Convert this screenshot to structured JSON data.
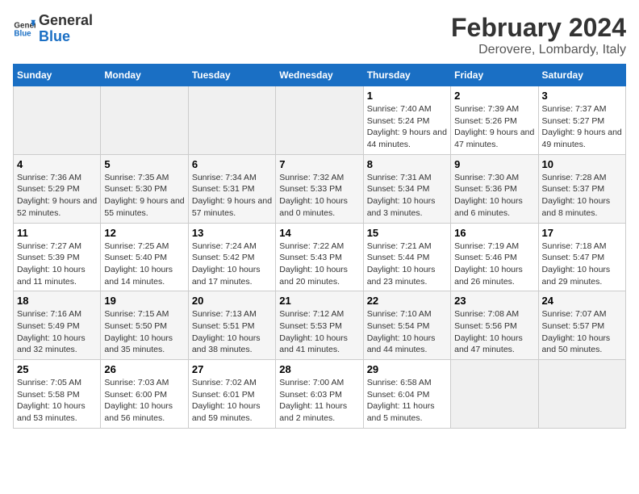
{
  "header": {
    "logo_line1": "General",
    "logo_line2": "Blue",
    "title": "February 2024",
    "subtitle": "Derovere, Lombardy, Italy"
  },
  "columns": [
    "Sunday",
    "Monday",
    "Tuesday",
    "Wednesday",
    "Thursday",
    "Friday",
    "Saturday"
  ],
  "weeks": [
    {
      "days": [
        {
          "num": "",
          "empty": true
        },
        {
          "num": "",
          "empty": true
        },
        {
          "num": "",
          "empty": true
        },
        {
          "num": "",
          "empty": true
        },
        {
          "num": "1",
          "sunrise": "Sunrise: 7:40 AM",
          "sunset": "Sunset: 5:24 PM",
          "daylight": "Daylight: 9 hours and 44 minutes."
        },
        {
          "num": "2",
          "sunrise": "Sunrise: 7:39 AM",
          "sunset": "Sunset: 5:26 PM",
          "daylight": "Daylight: 9 hours and 47 minutes."
        },
        {
          "num": "3",
          "sunrise": "Sunrise: 7:37 AM",
          "sunset": "Sunset: 5:27 PM",
          "daylight": "Daylight: 9 hours and 49 minutes."
        }
      ]
    },
    {
      "days": [
        {
          "num": "4",
          "sunrise": "Sunrise: 7:36 AM",
          "sunset": "Sunset: 5:29 PM",
          "daylight": "Daylight: 9 hours and 52 minutes."
        },
        {
          "num": "5",
          "sunrise": "Sunrise: 7:35 AM",
          "sunset": "Sunset: 5:30 PM",
          "daylight": "Daylight: 9 hours and 55 minutes."
        },
        {
          "num": "6",
          "sunrise": "Sunrise: 7:34 AM",
          "sunset": "Sunset: 5:31 PM",
          "daylight": "Daylight: 9 hours and 57 minutes."
        },
        {
          "num": "7",
          "sunrise": "Sunrise: 7:32 AM",
          "sunset": "Sunset: 5:33 PM",
          "daylight": "Daylight: 10 hours and 0 minutes."
        },
        {
          "num": "8",
          "sunrise": "Sunrise: 7:31 AM",
          "sunset": "Sunset: 5:34 PM",
          "daylight": "Daylight: 10 hours and 3 minutes."
        },
        {
          "num": "9",
          "sunrise": "Sunrise: 7:30 AM",
          "sunset": "Sunset: 5:36 PM",
          "daylight": "Daylight: 10 hours and 6 minutes."
        },
        {
          "num": "10",
          "sunrise": "Sunrise: 7:28 AM",
          "sunset": "Sunset: 5:37 PM",
          "daylight": "Daylight: 10 hours and 8 minutes."
        }
      ]
    },
    {
      "days": [
        {
          "num": "11",
          "sunrise": "Sunrise: 7:27 AM",
          "sunset": "Sunset: 5:39 PM",
          "daylight": "Daylight: 10 hours and 11 minutes."
        },
        {
          "num": "12",
          "sunrise": "Sunrise: 7:25 AM",
          "sunset": "Sunset: 5:40 PM",
          "daylight": "Daylight: 10 hours and 14 minutes."
        },
        {
          "num": "13",
          "sunrise": "Sunrise: 7:24 AM",
          "sunset": "Sunset: 5:42 PM",
          "daylight": "Daylight: 10 hours and 17 minutes."
        },
        {
          "num": "14",
          "sunrise": "Sunrise: 7:22 AM",
          "sunset": "Sunset: 5:43 PM",
          "daylight": "Daylight: 10 hours and 20 minutes."
        },
        {
          "num": "15",
          "sunrise": "Sunrise: 7:21 AM",
          "sunset": "Sunset: 5:44 PM",
          "daylight": "Daylight: 10 hours and 23 minutes."
        },
        {
          "num": "16",
          "sunrise": "Sunrise: 7:19 AM",
          "sunset": "Sunset: 5:46 PM",
          "daylight": "Daylight: 10 hours and 26 minutes."
        },
        {
          "num": "17",
          "sunrise": "Sunrise: 7:18 AM",
          "sunset": "Sunset: 5:47 PM",
          "daylight": "Daylight: 10 hours and 29 minutes."
        }
      ]
    },
    {
      "days": [
        {
          "num": "18",
          "sunrise": "Sunrise: 7:16 AM",
          "sunset": "Sunset: 5:49 PM",
          "daylight": "Daylight: 10 hours and 32 minutes."
        },
        {
          "num": "19",
          "sunrise": "Sunrise: 7:15 AM",
          "sunset": "Sunset: 5:50 PM",
          "daylight": "Daylight: 10 hours and 35 minutes."
        },
        {
          "num": "20",
          "sunrise": "Sunrise: 7:13 AM",
          "sunset": "Sunset: 5:51 PM",
          "daylight": "Daylight: 10 hours and 38 minutes."
        },
        {
          "num": "21",
          "sunrise": "Sunrise: 7:12 AM",
          "sunset": "Sunset: 5:53 PM",
          "daylight": "Daylight: 10 hours and 41 minutes."
        },
        {
          "num": "22",
          "sunrise": "Sunrise: 7:10 AM",
          "sunset": "Sunset: 5:54 PM",
          "daylight": "Daylight: 10 hours and 44 minutes."
        },
        {
          "num": "23",
          "sunrise": "Sunrise: 7:08 AM",
          "sunset": "Sunset: 5:56 PM",
          "daylight": "Daylight: 10 hours and 47 minutes."
        },
        {
          "num": "24",
          "sunrise": "Sunrise: 7:07 AM",
          "sunset": "Sunset: 5:57 PM",
          "daylight": "Daylight: 10 hours and 50 minutes."
        }
      ]
    },
    {
      "days": [
        {
          "num": "25",
          "sunrise": "Sunrise: 7:05 AM",
          "sunset": "Sunset: 5:58 PM",
          "daylight": "Daylight: 10 hours and 53 minutes."
        },
        {
          "num": "26",
          "sunrise": "Sunrise: 7:03 AM",
          "sunset": "Sunset: 6:00 PM",
          "daylight": "Daylight: 10 hours and 56 minutes."
        },
        {
          "num": "27",
          "sunrise": "Sunrise: 7:02 AM",
          "sunset": "Sunset: 6:01 PM",
          "daylight": "Daylight: 10 hours and 59 minutes."
        },
        {
          "num": "28",
          "sunrise": "Sunrise: 7:00 AM",
          "sunset": "Sunset: 6:03 PM",
          "daylight": "Daylight: 11 hours and 2 minutes."
        },
        {
          "num": "29",
          "sunrise": "Sunrise: 6:58 AM",
          "sunset": "Sunset: 6:04 PM",
          "daylight": "Daylight: 11 hours and 5 minutes."
        },
        {
          "num": "",
          "empty": true
        },
        {
          "num": "",
          "empty": true
        }
      ]
    }
  ]
}
